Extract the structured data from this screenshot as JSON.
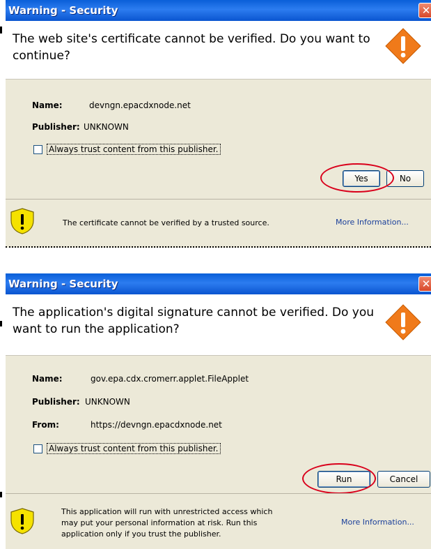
{
  "dialogs": [
    {
      "title": "Warning - Security",
      "close_glyph": "✕",
      "heading": "The web site's certificate cannot be verified.  Do you want to continue?",
      "fields": [
        {
          "label": "Name:",
          "value": "devngn.epacdxnode.net"
        },
        {
          "label": "Publisher:",
          "value": "UNKNOWN"
        }
      ],
      "checkbox_label": "Always trust content from this publisher.",
      "buttons": {
        "primary": "Yes",
        "secondary": "No"
      },
      "footer_text": "The certificate cannot be verified by a trusted source.",
      "more_info": "More Information..."
    },
    {
      "title": "Warning - Security",
      "close_glyph": "✕",
      "heading": "The application's digital signature cannot be verified. Do you want to run the application?",
      "fields": [
        {
          "label": "Name:",
          "value": "gov.epa.cdx.cromerr.applet.FileApplet"
        },
        {
          "label": "Publisher:",
          "value": "UNKNOWN"
        },
        {
          "label": "From:",
          "value": "https://devngn.epacdxnode.net"
        }
      ],
      "checkbox_label": "Always trust content from this publisher.",
      "buttons": {
        "primary": "Run",
        "secondary": "Cancel"
      },
      "footer_text": "This application will run with unrestricted access which may put your personal information at risk. Run this application only if you trust the publisher.",
      "more_info": "More Information..."
    }
  ],
  "colors": {
    "titlebar": "#0a5fd8",
    "dialog_bg": "#ece9d8",
    "warning_orange": "#f07a1a",
    "highlight_red": "#d9001b",
    "shield_yellow": "#f5e200"
  }
}
